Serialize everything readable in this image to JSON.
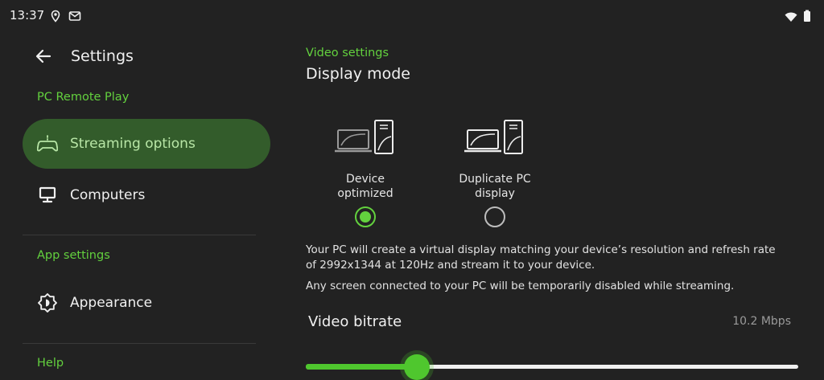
{
  "status_bar": {
    "time": "13:37",
    "left_icons": [
      "location-icon",
      "gmail-icon"
    ],
    "right_icons": [
      "wifi-icon",
      "battery-icon"
    ]
  },
  "nav": {
    "title": "Settings",
    "sections": [
      {
        "label": "PC Remote Play",
        "items": [
          {
            "label": "Streaming options",
            "icon": "gamepad-icon",
            "active": true
          },
          {
            "label": "Computers",
            "icon": "monitor-icon",
            "active": false
          }
        ]
      },
      {
        "label": "App settings",
        "items": [
          {
            "label": "Appearance",
            "icon": "brightness-icon",
            "active": false
          }
        ]
      },
      {
        "label": "Help",
        "items": []
      }
    ]
  },
  "content": {
    "overline": "Video settings",
    "heading": "Display mode",
    "modes": [
      {
        "label_line1": "Device",
        "label_line2": "optimized",
        "selected": true
      },
      {
        "label_line1": "Duplicate PC",
        "label_line2": "display",
        "selected": false
      }
    ],
    "description_1": "Your PC will create a virtual display matching your device’s resolution and refresh rate of 2992x1344 at 120Hz and stream it to your device.",
    "description_2": "Any screen connected to your PC will be temporarily disabled while streaming.",
    "bitrate": {
      "label": "Video bitrate",
      "value": "10.2 Mbps",
      "slider_fraction": 0.225
    }
  },
  "colors": {
    "accent": "#63d13e",
    "background": "#222222",
    "active_nav_bg": "#335c2b"
  }
}
